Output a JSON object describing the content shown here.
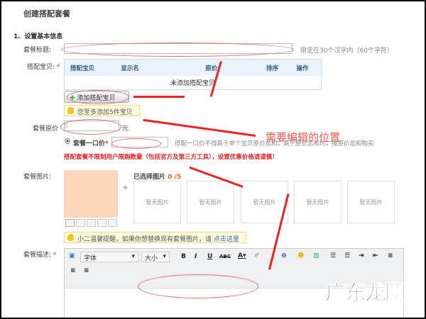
{
  "page_title": "创建搭配套餐",
  "section": "1、设置基本信息",
  "title_field": {
    "label": "套餐标题:",
    "value": "",
    "hint": "限定在30个汉字内（60个字符）"
  },
  "items": {
    "label": "搭配宝贝:",
    "columns": [
      "搭配宝贝",
      "显示名",
      "原价",
      "排序",
      "操作"
    ],
    "empty": "未添加搭配宝贝",
    "add_button": "添加搭配宝贝",
    "tip": "您至多添加5件宝贝"
  },
  "price": {
    "label": "套餐原价",
    "value": "0",
    "unit": "元"
  },
  "fixed_price": {
    "label": "套餐一口价",
    "value": "",
    "hint": "搭配一口价不得高于单个宝贝原价总和，高于原价总和时，按原价总和购买"
  },
  "warning": "搭配套餐不限制用户限购数量（包括官方及第三方工具），设置优惠价格请谨慎！",
  "images": {
    "label": "套餐图片:",
    "selected_label": "已选择图片",
    "selected_count": "0 /5",
    "placeholder": "暂无图片",
    "tip": "小二温馨提醒，如果你想替换现有套餐图片，请",
    "tip_link": "点击这里"
  },
  "description": {
    "label": "套餐描述:",
    "font": "字体",
    "size": "大小"
  },
  "annotation": "需要编辑的位置",
  "watermark": "广东龙网"
}
